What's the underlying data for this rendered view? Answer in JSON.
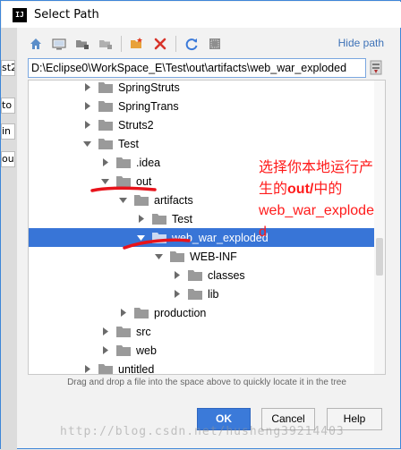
{
  "window": {
    "title": "Select Path",
    "app_icon_text": "IJ"
  },
  "background_fragments": [
    "st2",
    "to",
    "in",
    "out"
  ],
  "toolbar": {
    "icons": [
      "home-icon",
      "desktop-icon",
      "project-folder-icon",
      "module-folder-icon",
      "new-folder-icon",
      "delete-icon",
      "refresh-icon",
      "show-hidden-icon"
    ],
    "hide_path_label": "Hide path"
  },
  "path": {
    "value": "D:\\Eclipse0\\WorkSpace_E\\Test\\out\\artifacts\\web_war_exploded"
  },
  "tree": {
    "rows": [
      {
        "label": "SpringStruts",
        "depth": 0,
        "expanded": false,
        "selected": false
      },
      {
        "label": "SpringTrans",
        "depth": 0,
        "expanded": false,
        "selected": false
      },
      {
        "label": "Struts2",
        "depth": 0,
        "expanded": false,
        "selected": false
      },
      {
        "label": "Test",
        "depth": 0,
        "expanded": true,
        "selected": false
      },
      {
        "label": ".idea",
        "depth": 1,
        "expanded": false,
        "selected": false
      },
      {
        "label": "out",
        "depth": 1,
        "expanded": true,
        "selected": false
      },
      {
        "label": "artifacts",
        "depth": 2,
        "expanded": true,
        "selected": false
      },
      {
        "label": "Test",
        "depth": 3,
        "expanded": false,
        "selected": false
      },
      {
        "label": "web_war_exploded",
        "depth": 3,
        "expanded": true,
        "selected": true
      },
      {
        "label": "WEB-INF",
        "depth": 4,
        "expanded": true,
        "selected": false
      },
      {
        "label": "classes",
        "depth": 5,
        "expanded": false,
        "selected": false
      },
      {
        "label": "lib",
        "depth": 5,
        "expanded": false,
        "selected": false
      },
      {
        "label": "production",
        "depth": 2,
        "expanded": false,
        "selected": false
      },
      {
        "label": "src",
        "depth": 1,
        "expanded": false,
        "selected": false
      },
      {
        "label": "web",
        "depth": 1,
        "expanded": false,
        "selected": false
      },
      {
        "label": "untitled",
        "depth": 0,
        "expanded": false,
        "selected": false
      }
    ]
  },
  "hint_text": "Drag and drop a file into the space above to quickly locate it in the tree",
  "annotation": {
    "line1": "选择你本地运行产",
    "line2_prefix": "生的",
    "line2_bold": "out/",
    "line2_suffix": "中的",
    "line3": "web_war_explode",
    "line4": "d"
  },
  "buttons": {
    "ok": "OK",
    "cancel": "Cancel",
    "help": "Help"
  },
  "watermark": "http://blog.csdn.net/husheng39214403",
  "colors": {
    "selection": "#3875d7",
    "annotation": "#ff1b1b",
    "link": "#3f73b8",
    "folder": "#9a9a9a"
  }
}
